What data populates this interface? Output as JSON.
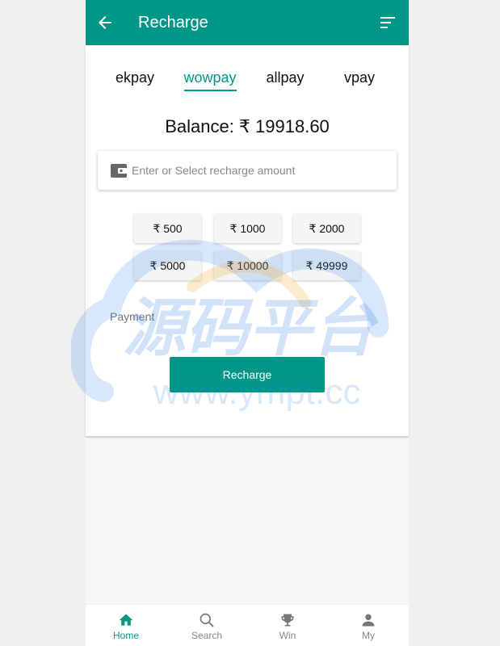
{
  "appbar": {
    "title": "Recharge"
  },
  "tabs": [
    {
      "label": "ekpay"
    },
    {
      "label": "wowpay"
    },
    {
      "label": "allpay"
    },
    {
      "label": "vpay"
    }
  ],
  "active_tab": "wowpay",
  "balance": {
    "text": "Balance: ₹ 19918.60"
  },
  "amount_input": {
    "placeholder": "Enter or Select recharge amount",
    "value": ""
  },
  "amount_options": [
    {
      "label": "₹ 500"
    },
    {
      "label": "₹ 1000"
    },
    {
      "label": "₹ 2000"
    },
    {
      "label": "₹ 5000"
    },
    {
      "label": "₹ 10000"
    },
    {
      "label": "₹ 49999"
    }
  ],
  "payment": {
    "label": "Payment"
  },
  "recharge_button": {
    "label": "Recharge"
  },
  "watermark": {
    "title": "源码平台",
    "url": "www.ympt.cc"
  },
  "bottom_nav": [
    {
      "label": "Home",
      "icon": "home-icon"
    },
    {
      "label": "Search",
      "icon": "search-icon"
    },
    {
      "label": "Win",
      "icon": "trophy-icon"
    },
    {
      "label": "My",
      "icon": "user-icon"
    }
  ],
  "colors": {
    "primary": "#009688",
    "background": "#f7f7f7",
    "watermark_blue": "#2f7ae5",
    "watermark_orange": "#f5a623"
  }
}
